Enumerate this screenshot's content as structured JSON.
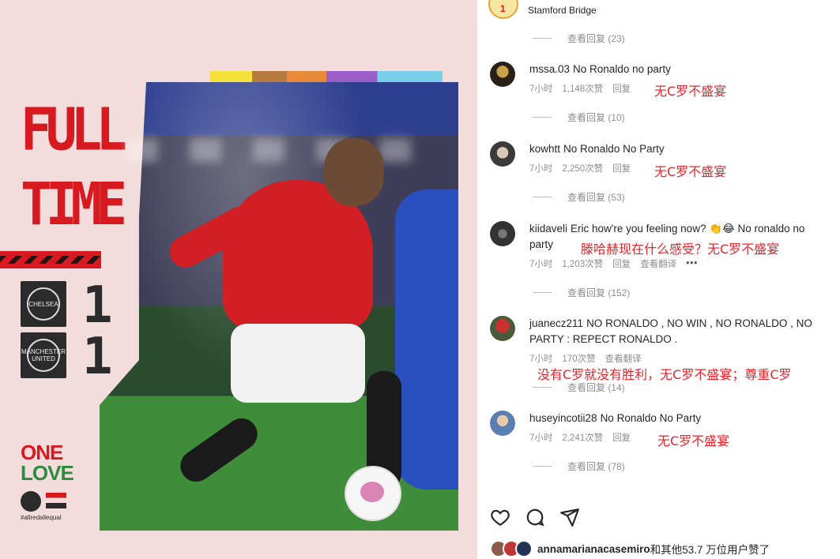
{
  "post": {
    "headline_line1": "FULL",
    "headline_line2": "TIME",
    "home_team_crest": "CHELSEA",
    "home_score": "1",
    "away_team_crest": "MANCHESTER UNITED",
    "away_score": "1",
    "campaign_line1": "ONE",
    "campaign_line2": "LOVE",
    "hashtag": "#allredallequal"
  },
  "panel": {
    "location": "Stamford Bridge",
    "top_replies": "查看回复 (23)",
    "comments": [
      {
        "user": "mssa.03",
        "text": "No Ronaldo no party",
        "time": "7小时",
        "likes": "1,148次赞",
        "reply": "回复",
        "translation": "无C罗不盛宴",
        "view_replies": "查看回复 (10)"
      },
      {
        "user": "kowhtt",
        "text": "No Ronaldo No Party",
        "time": "7小时",
        "likes": "2,250次赞",
        "reply": "回复",
        "translation": "无C罗不盛宴",
        "view_replies": "查看回复 (53)"
      },
      {
        "user": "kiidaveli",
        "text": "Eric how're you feeling now? 👏😂 No ronaldo no party",
        "time": "7小时",
        "likes": "1,203次赞",
        "reply": "回复",
        "see_translation": "查看翻译",
        "more": "•••",
        "translation": "滕哈赫现在什么感受？无C罗不盛宴",
        "view_replies": "查看回复 (152)"
      },
      {
        "user": "juanecz211",
        "text": "NO RONALDO , NO WIN , NO RONALDO , NO PARTY : REPECT RONALDO .",
        "time": "7小时",
        "likes": "170次赞",
        "see_translation": "查看翻译",
        "translation": "没有C罗就没有胜利，无C罗不盛宴；尊重C罗",
        "view_replies": "查看回复 (14)"
      },
      {
        "user": "huseyincotii28",
        "text": "No Ronaldo No Party",
        "time": "7小时",
        "likes": "2,241次赞",
        "reply": "回复",
        "translation": "无C罗不盛宴",
        "view_replies": "查看回复 (78)"
      }
    ],
    "liked_by": "annamarianacasemiro",
    "liked_by_rest": "和其他53.7 万位用户赞了"
  },
  "colors": {
    "accent_red": "#e8232a",
    "muted": "#8e8e8e"
  }
}
